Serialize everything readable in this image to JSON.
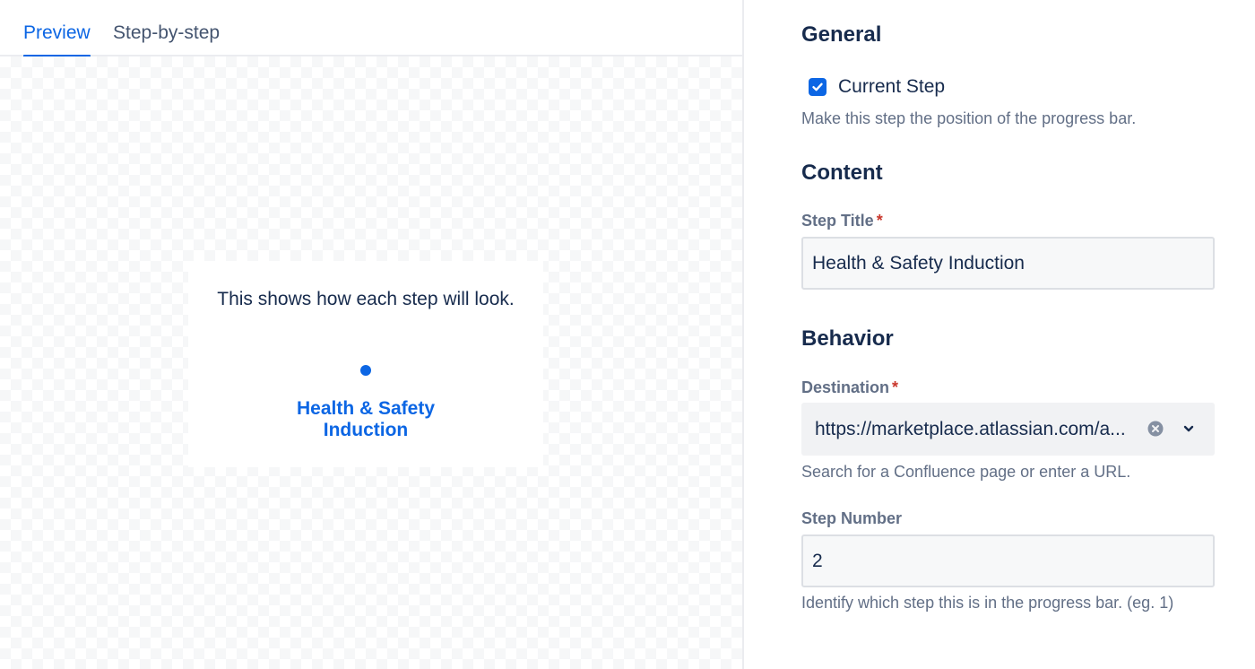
{
  "tabs": [
    {
      "label": "Preview",
      "active": true
    },
    {
      "label": "Step-by-step",
      "active": false
    }
  ],
  "preview": {
    "description": "This shows how each step will look.",
    "step_title": "Health & Safety Induction"
  },
  "settings": {
    "general": {
      "heading": "General",
      "current_step": {
        "label": "Current Step",
        "checked": true,
        "helper": "Make this step the position of the progress bar."
      }
    },
    "content": {
      "heading": "Content",
      "step_title": {
        "label": "Step Title",
        "required_mark": "*",
        "value": "Health & Safety Induction"
      }
    },
    "behavior": {
      "heading": "Behavior",
      "destination": {
        "label": "Destination",
        "required_mark": "*",
        "value": "https://marketplace.atlassian.com/a...",
        "helper": "Search for a Confluence page or enter a URL."
      },
      "step_number": {
        "label": "Step Number",
        "value": "2",
        "helper": "Identify which step this is in the progress bar. (eg. 1)"
      }
    }
  },
  "colors": {
    "accent": "#0c66e4",
    "text": "#172b4d",
    "subtle_text": "#626f86",
    "required": "#c9372c"
  }
}
